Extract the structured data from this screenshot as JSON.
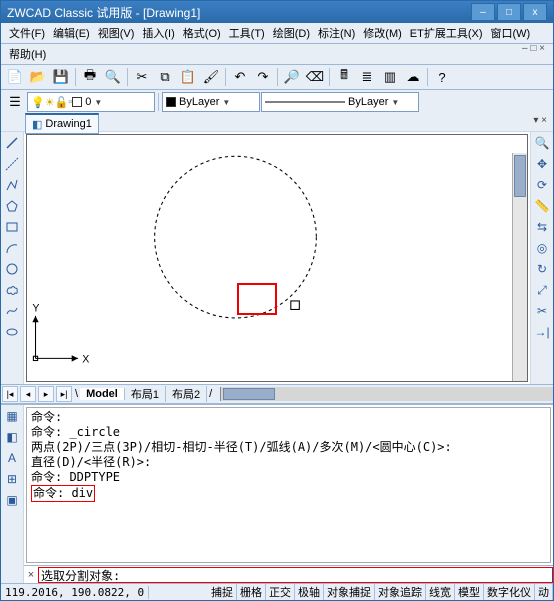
{
  "window": {
    "title": "ZWCAD Classic 试用版 - [Drawing1]"
  },
  "menu": {
    "items1": [
      "文件(F)",
      "编辑(E)",
      "视图(V)",
      "插入(I)",
      "格式(O)",
      "工具(T)",
      "绘图(D)",
      "标注(N)",
      "修改(M)",
      "ET扩展工具(X)",
      "窗口(W)"
    ],
    "items2": [
      "帮助(H)"
    ]
  },
  "toolbar1_icons": [
    "new-icon",
    "open-icon",
    "save-icon",
    "print-icon",
    "preview-icon",
    "cut-icon",
    "copy-icon",
    "paste-icon",
    "matchprop-icon",
    "undo-icon",
    "redo-icon",
    "find-icon",
    "erase-icon",
    "calc-icon",
    "linetype-icon",
    "palette-icon",
    "cloud-icon",
    "help-icon"
  ],
  "toolbar2": {
    "layer_value": "0",
    "color_value": "ByLayer",
    "lt_value": "ByLayer"
  },
  "doc_tab": "Drawing1",
  "left_tools": [
    "line-icon",
    "xline-icon",
    "pline-icon",
    "polygon-icon",
    "rect-icon",
    "arc-icon",
    "circle-icon",
    "revcloud-icon",
    "spline-icon",
    "ellipse-icon",
    "arc2-icon",
    "block-icon",
    "point-icon",
    "hatch-icon",
    "region-icon",
    "text-icon"
  ],
  "left_tools2": [
    "table-icon",
    "gradient-icon",
    "mtext-icon",
    "table2-icon",
    "region2-icon"
  ],
  "right_tools": [
    "zoom-icon",
    "pan-icon",
    "orbit-icon",
    "measure-icon",
    "mirror-icon",
    "offset-icon",
    "rotate-icon",
    "scale-icon",
    "trim-icon",
    "extend-icon",
    "fillet-icon",
    "explode-icon",
    "layer-icon",
    "dim-icon",
    "prop-icon"
  ],
  "model_tabs": {
    "active": "Model",
    "others": [
      "布局1",
      "布局2"
    ]
  },
  "cmd_history": [
    "命令:",
    "命令: _circle",
    "两点(2P)/三点(3P)/相切-相切-半径(T)/弧线(A)/多次(M)/<圆中心(C)>:",
    "直径(D)/<半径(R)>:",
    "命令: DDPTYPE",
    "命令: div"
  ],
  "cmd_prompt": "选取分割对象:",
  "status": {
    "coord": "119.2016,  190.0822,  0",
    "buttons": [
      "捕捉",
      "栅格",
      "正交",
      "极轴",
      "对象捕捉",
      "对象追踪",
      "线宽",
      "模型",
      "数字化仪",
      "动"
    ]
  },
  "colors": {
    "title_bg": "#2a6aa8",
    "panel": "#e8eef6",
    "highlight": "#e00"
  }
}
